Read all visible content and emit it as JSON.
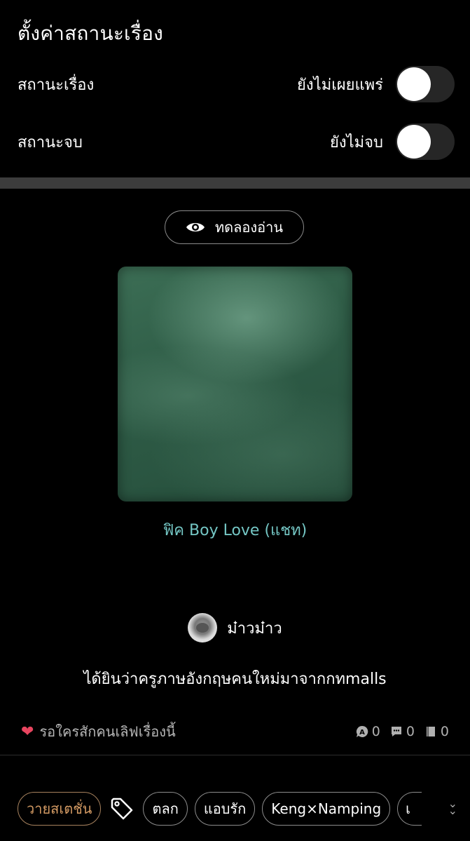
{
  "page": {
    "title": "ตั้งค่าสถานะเรื่อง"
  },
  "settings": [
    {
      "label": "สถานะเรื่อง",
      "value": "ยังไม่เผยแพร่",
      "on": false
    },
    {
      "label": "สถานะจบ",
      "value": "ยังไม่จบ",
      "on": false
    }
  ],
  "preview_button": {
    "label": "ทดลองอ่าน",
    "icon": "eye-icon"
  },
  "story": {
    "genre": "ฟิค Boy Love (แชท)",
    "author": "ม๋าวม๋าว",
    "synopsis": "ได้ยินว่าครูภาษอังกฤษคนใหม่มาจากกทmalls",
    "love_text": "รอใครสักคนเลิฟเรื่องนี้",
    "stats": {
      "reads": "0",
      "comments": "0",
      "bookmarks": "0"
    }
  },
  "tags": {
    "category": "วายสเตชั่น",
    "items": [
      "ตลก",
      "แอบรัก",
      "Keng×Namping",
      "เ"
    ]
  },
  "colors": {
    "genre_text": "#74c6c4",
    "heart": "#e8455f",
    "category_chip": "#d39a63"
  }
}
